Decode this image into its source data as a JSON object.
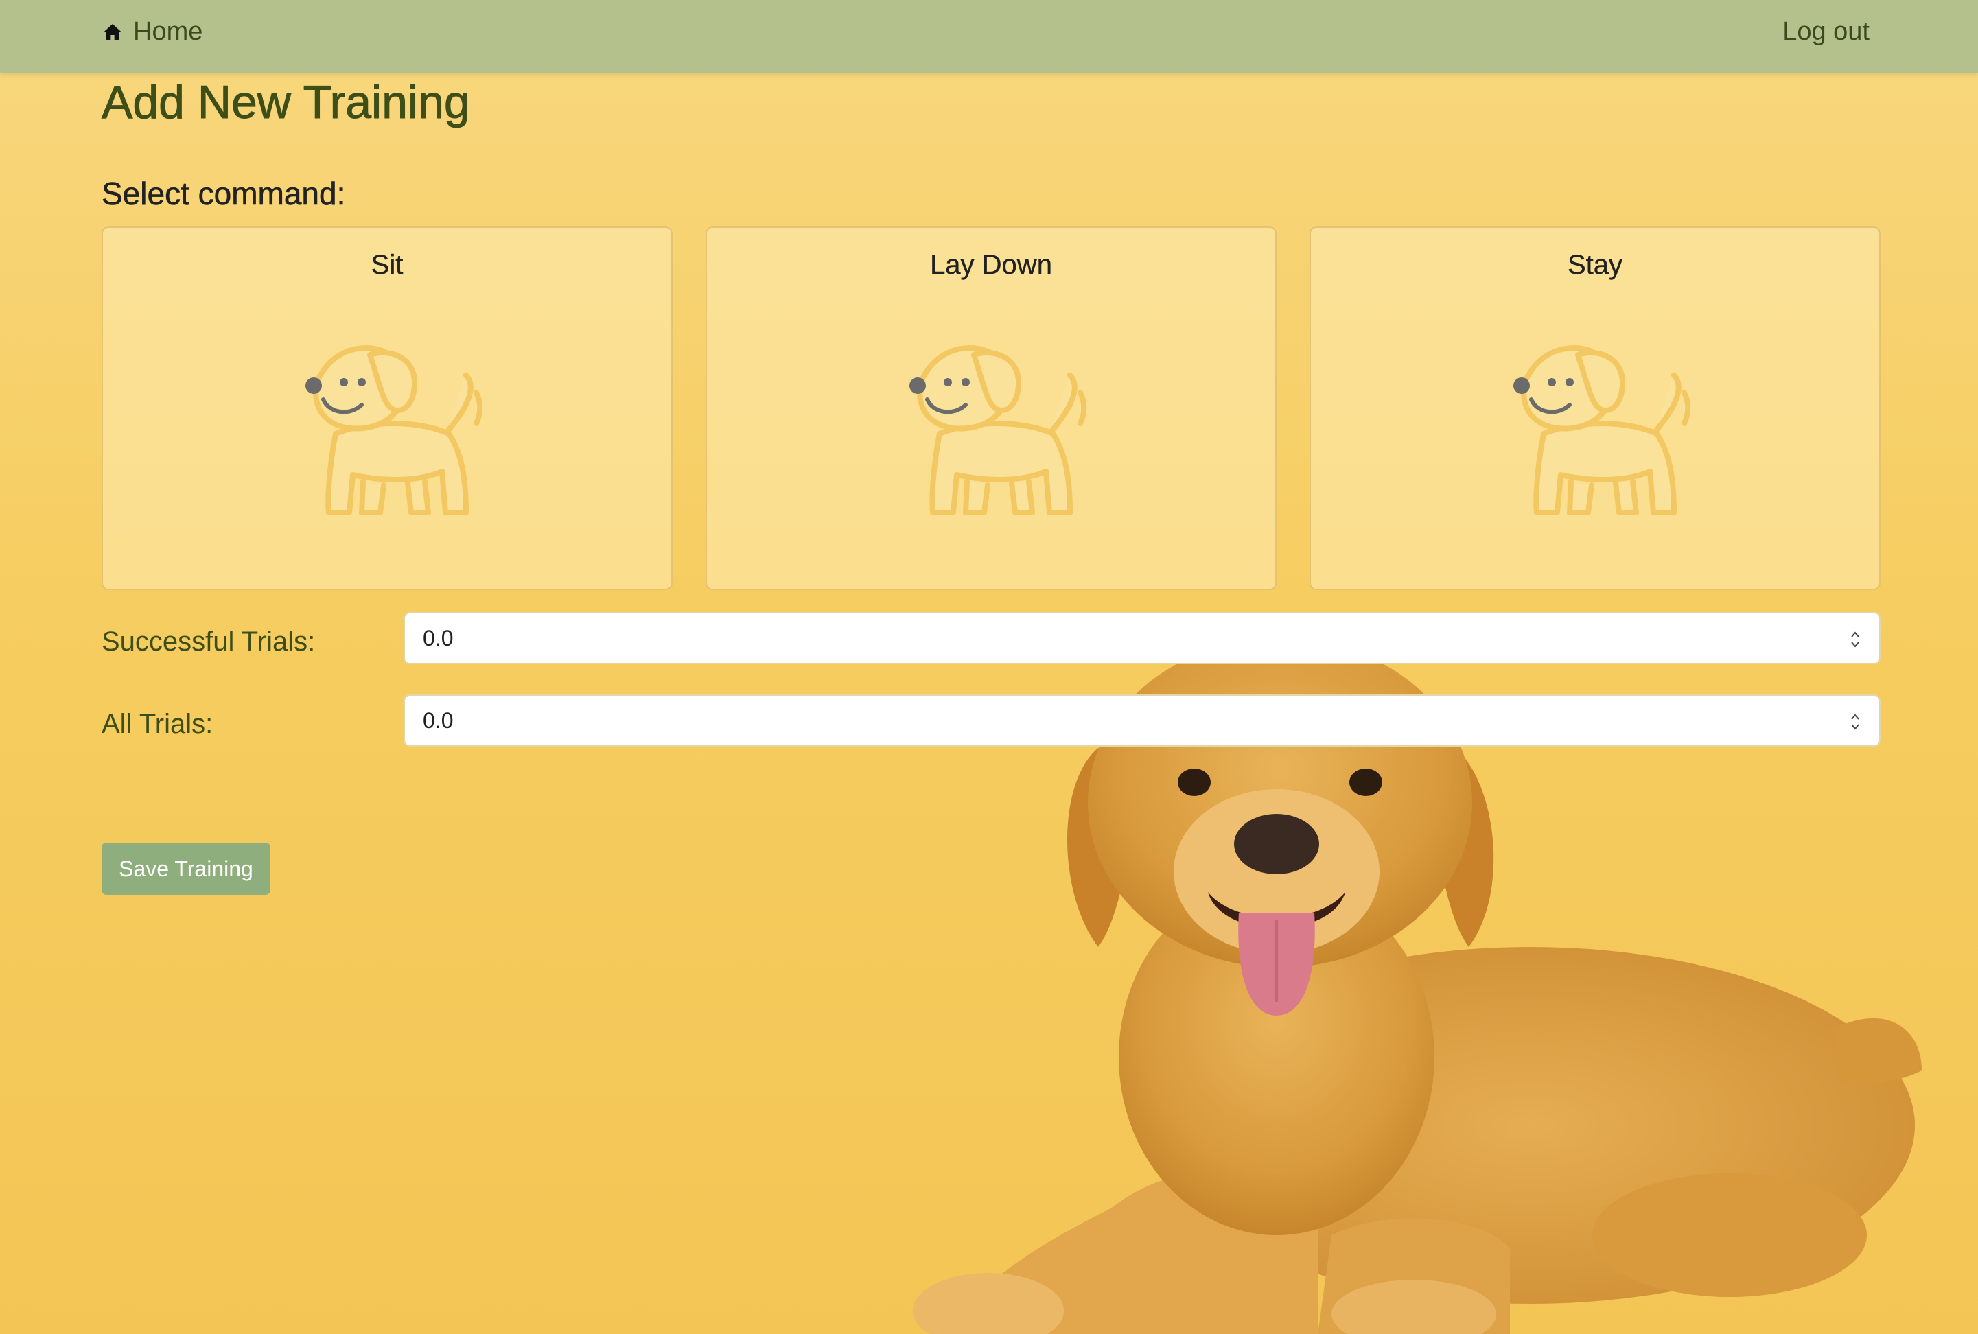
{
  "nav": {
    "home_label": "Home",
    "logout_label": "Log out"
  },
  "page": {
    "title": "Add New Training",
    "select_command_label": "Select command:"
  },
  "commands": [
    {
      "label": "Sit",
      "icon": "dog-icon"
    },
    {
      "label": "Lay Down",
      "icon": "dog-icon"
    },
    {
      "label": "Stay",
      "icon": "dog-icon"
    }
  ],
  "form": {
    "successful_trials_label": "Successful Trials:",
    "successful_trials_value": "0.0",
    "all_trials_label": "All Trials:",
    "all_trials_value": "0.0",
    "save_label": "Save Training"
  },
  "colors": {
    "navbar": "#b4c18d",
    "background": "#f6cd60",
    "title": "#3e4e18",
    "button": "#8fae7d"
  }
}
